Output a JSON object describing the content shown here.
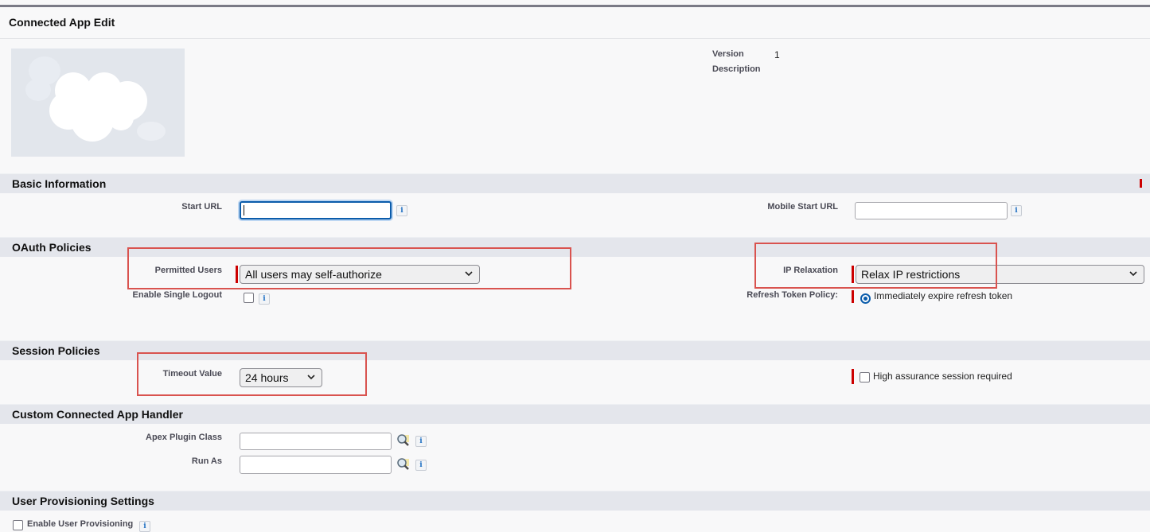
{
  "page": {
    "title": "Connected App Edit",
    "logo_icon": "salesforce-cloud-icon"
  },
  "meta": {
    "version_label": "Version",
    "version_value": "1",
    "description_label": "Description",
    "description_value": ""
  },
  "sections": {
    "basic": {
      "title": "Basic Information",
      "start_url_label": "Start URL",
      "start_url_value": "",
      "mobile_start_url_label": "Mobile Start URL",
      "mobile_start_url_value": ""
    },
    "oauth": {
      "title": "OAuth Policies",
      "permitted_users_label": "Permitted Users",
      "permitted_users_value": "All users may self-authorize",
      "enable_single_logout_label": "Enable Single Logout",
      "enable_single_logout_checked": false,
      "ip_relaxation_label": "IP Relaxation",
      "ip_relaxation_value": "Relax IP restrictions",
      "refresh_token_policy_label": "Refresh Token Policy:",
      "refresh_token_option": "Immediately expire refresh token",
      "refresh_token_selected": true
    },
    "session": {
      "title": "Session Policies",
      "timeout_label": "Timeout Value",
      "timeout_value": "24 hours",
      "high_assurance_label": "High assurance session required",
      "high_assurance_checked": false
    },
    "handler": {
      "title": "Custom Connected App Handler",
      "apex_plugin_label": "Apex Plugin Class",
      "apex_plugin_value": "",
      "run_as_label": "Run As",
      "run_as_value": ""
    },
    "provisioning": {
      "title": "User Provisioning Settings",
      "enable_label": "Enable User Provisioning",
      "enable_checked": false
    }
  },
  "icons": {
    "info": "i",
    "lookup": "magnifier-lookup-icon",
    "chevron": "chevron-down-icon"
  },
  "colors": {
    "required": "#cc0000",
    "highlight": "#d9534f",
    "focus": "#0b5cab"
  }
}
